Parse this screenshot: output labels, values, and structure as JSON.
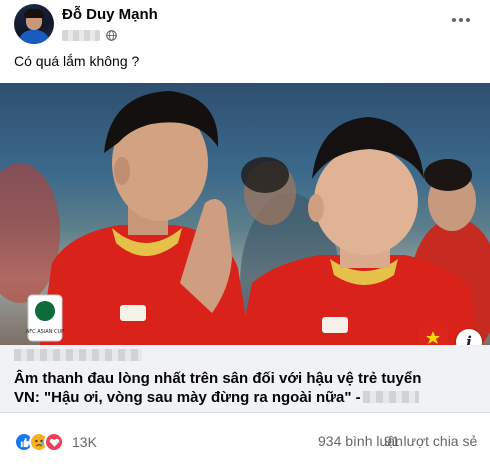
{
  "post": {
    "author": "Đỗ Duy Mạnh",
    "caption": "Có quá lắm không ?",
    "link": {
      "headline_line1": "Âm thanh đau lòng nhất trên sân đối với hậu vệ trẻ tuyển",
      "headline_line2": "VN: \"Hậu ơi, vòng sau mày đừng ra ngoài nữa\" -",
      "badge_text": "AFC ASIAN CUP",
      "info_symbol": "i"
    },
    "stats": {
      "reactions": "13K",
      "comments": "934 bình luận",
      "shares": "91 lượt chia sẻ"
    }
  },
  "icons": {
    "privacy": "globe-icon",
    "more": "more-horizontal-icon",
    "reactions": [
      "like-icon",
      "sad-icon",
      "love-icon"
    ]
  },
  "colors": {
    "like": "#1877f2",
    "sad": "#f7b125",
    "love": "#f33e58",
    "jersey_red": "#d8221a",
    "secondary_text": "#65676b",
    "link_card_bg": "#f0f2f5"
  }
}
